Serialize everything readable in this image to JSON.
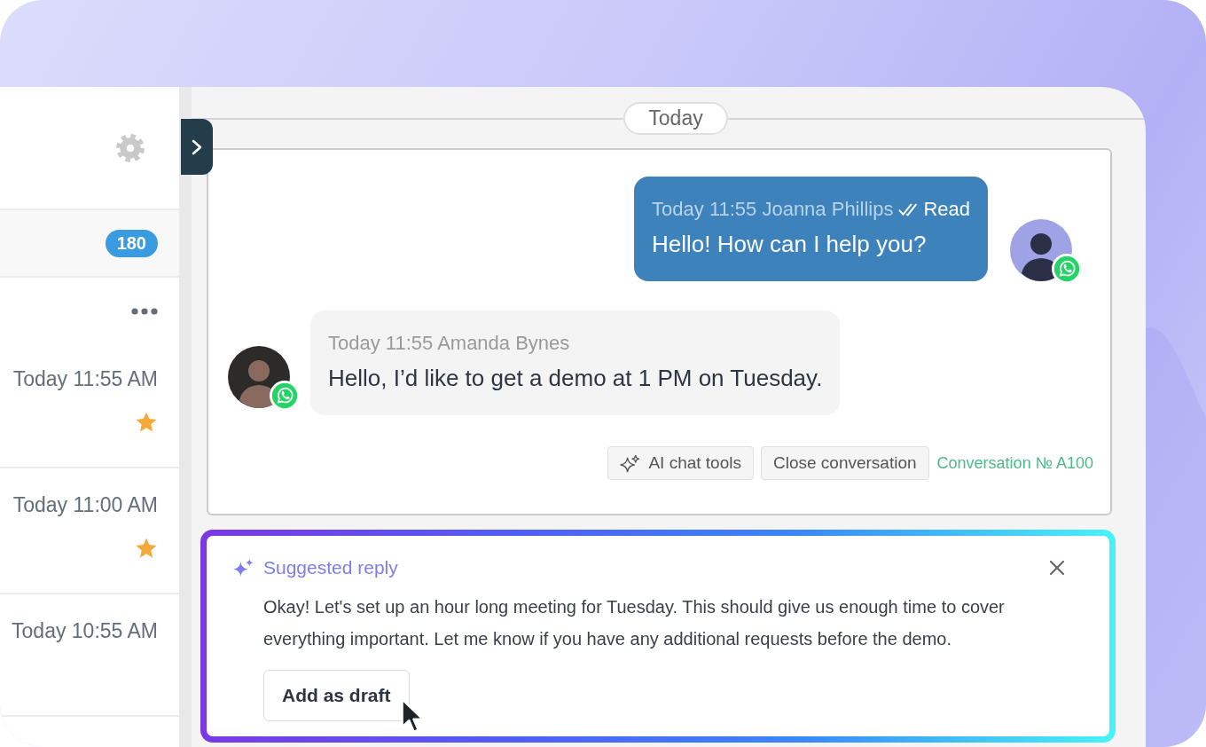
{
  "sidebar": {
    "unread_count": "180",
    "conversations": [
      {
        "time": "Today 11:55 AM",
        "more_button": true,
        "starred": true
      },
      {
        "time": "Today 11:00 AM",
        "more_button": false,
        "starred": true
      },
      {
        "time": "Today 10:55 AM",
        "more_button": false,
        "starred": false
      }
    ]
  },
  "chat": {
    "date_label": "Today",
    "messages": [
      {
        "kind": "outgoing",
        "meta": "Today 11:55 Joanna Phillips",
        "status": "Read",
        "text": "Hello! How can I help you?"
      },
      {
        "kind": "incoming",
        "meta": "Today 11:55 Amanda Bynes",
        "text": "Hello, I’d like to get a demo at 1 PM on Tuesday."
      }
    ],
    "actions": [
      {
        "kind": "ai",
        "label": "AI chat tools"
      },
      {
        "kind": "close",
        "label": "Close conversation"
      }
    ],
    "conversation_number": "Conversation № A100"
  },
  "suggestion": {
    "title": "Suggested reply",
    "text": "Okay! Let's set up an hour long meeting for Tuesday. This should give us enough time to cover everything important. Let me know if you have any additional requests before the demo.",
    "button": "Add as draft"
  }
}
